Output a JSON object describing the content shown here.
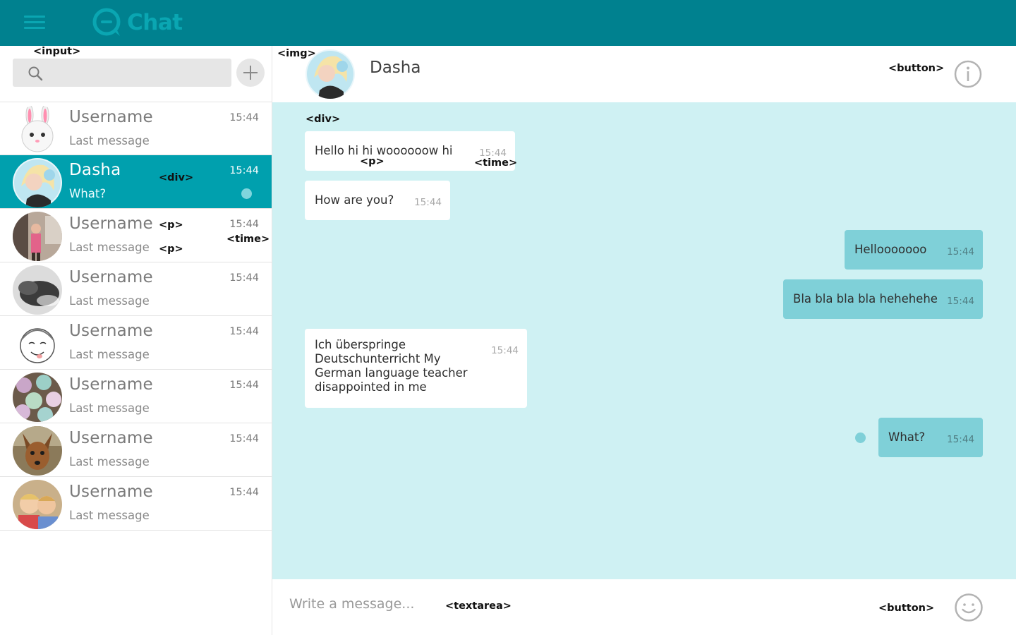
{
  "app": {
    "title": "Chat",
    "brand_color": "#00818f",
    "accent_color": "#00a0ae",
    "icons": {
      "menu": "hamburger-icon",
      "logo": "chat-bubble-icon",
      "search": "search-icon",
      "add": "plus-icon",
      "info": "info-icon",
      "emoji": "smiley-icon"
    }
  },
  "search": {
    "placeholder": "",
    "value": ""
  },
  "chats": [
    {
      "name": "Username",
      "last": "Last message",
      "time": "15:44",
      "avatar": "bunny"
    },
    {
      "name": "Dasha",
      "last": "What?",
      "time": "15:44",
      "avatar": "dasha",
      "active": true,
      "unread": true
    },
    {
      "name": "Username",
      "last": "Last message",
      "time": "15:44",
      "avatar": "woman"
    },
    {
      "name": "Username",
      "last": "Last message",
      "time": "15:44",
      "avatar": "dog-sleeping"
    },
    {
      "name": "Username",
      "last": "Last message",
      "time": "15:44",
      "avatar": "sketch-face"
    },
    {
      "name": "Username",
      "last": "Last message",
      "time": "15:44",
      "avatar": "cupcakes"
    },
    {
      "name": "Username",
      "last": "Last message",
      "time": "15:44",
      "avatar": "dog"
    },
    {
      "name": "Username",
      "last": "Last message",
      "time": "15:44",
      "avatar": "kids"
    }
  ],
  "conversation": {
    "name": "Dasha",
    "messages": [
      {
        "direction": "in",
        "text": "Hello hi hi woooooow hi",
        "time": "15:44"
      },
      {
        "direction": "in",
        "text": "How are you?",
        "time": "15:44"
      },
      {
        "direction": "out",
        "text": "Hellooooooo",
        "time": "15:44"
      },
      {
        "direction": "out",
        "text": "Bla bla bla bla hehehehe",
        "time": "15:44"
      },
      {
        "direction": "in",
        "text_lines": [
          "Ich überspringe",
          "Deutschunterricht My",
          "German language teacher",
          "disappointed in me"
        ],
        "time": "15:44"
      },
      {
        "direction": "out",
        "text": "What?",
        "time": "15:44",
        "status": "sent"
      }
    ]
  },
  "composer": {
    "placeholder": "Write a message..."
  },
  "annotations": {
    "input": "<input>",
    "img": "<img>",
    "button": "<button>",
    "div": "<div>",
    "p": "<p>",
    "time": "<time>",
    "textarea": "<textarea>"
  }
}
